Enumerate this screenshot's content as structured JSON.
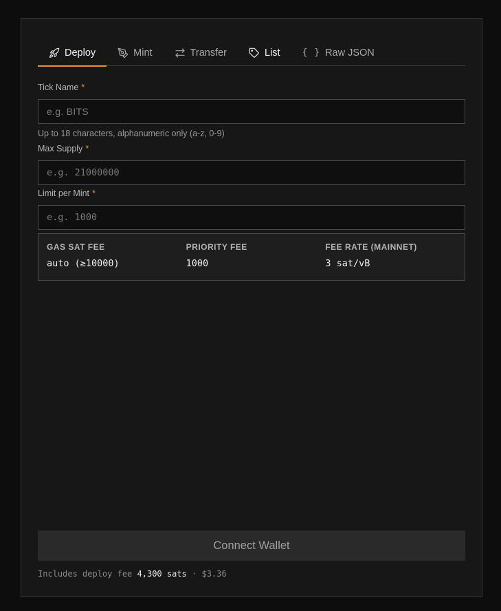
{
  "tabs": [
    {
      "label": "Deploy",
      "icon": "rocket-icon"
    },
    {
      "label": "Mint",
      "icon": "pen-nib-icon"
    },
    {
      "label": "Transfer",
      "icon": "arrows-swap-icon"
    },
    {
      "label": "List",
      "icon": "tag-icon"
    },
    {
      "label": "Raw JSON",
      "icon": "braces-icon",
      "glyph": "{ }"
    }
  ],
  "form": {
    "tick": {
      "label": "Tick Name",
      "required": "*",
      "placeholder": "e.g. BITS",
      "hint": "Up to 18 characters, alphanumeric only (a-z, 0-9)"
    },
    "max_supply": {
      "label": "Max Supply",
      "required": "*",
      "placeholder": "e.g. 21000000"
    },
    "limit": {
      "label": "Limit per Mint",
      "required": "*",
      "placeholder": "e.g. 1000"
    }
  },
  "fees": {
    "gas": {
      "label": "GAS SAT FEE",
      "value": "auto (≥10000)"
    },
    "priority": {
      "label": "PRIORITY FEE",
      "value": "1000"
    },
    "rate": {
      "label": "FEE RATE (MAINNET)",
      "value": "3 sat/vB"
    }
  },
  "action": {
    "connect_label": "Connect Wallet"
  },
  "footer": {
    "prefix": "Includes deploy fee",
    "sats": "4,300 sats",
    "sep": "·",
    "usd": "$3.36"
  },
  "colors": {
    "accent": "#e8913a",
    "background": "#171717",
    "page": "#0d0d0d"
  }
}
